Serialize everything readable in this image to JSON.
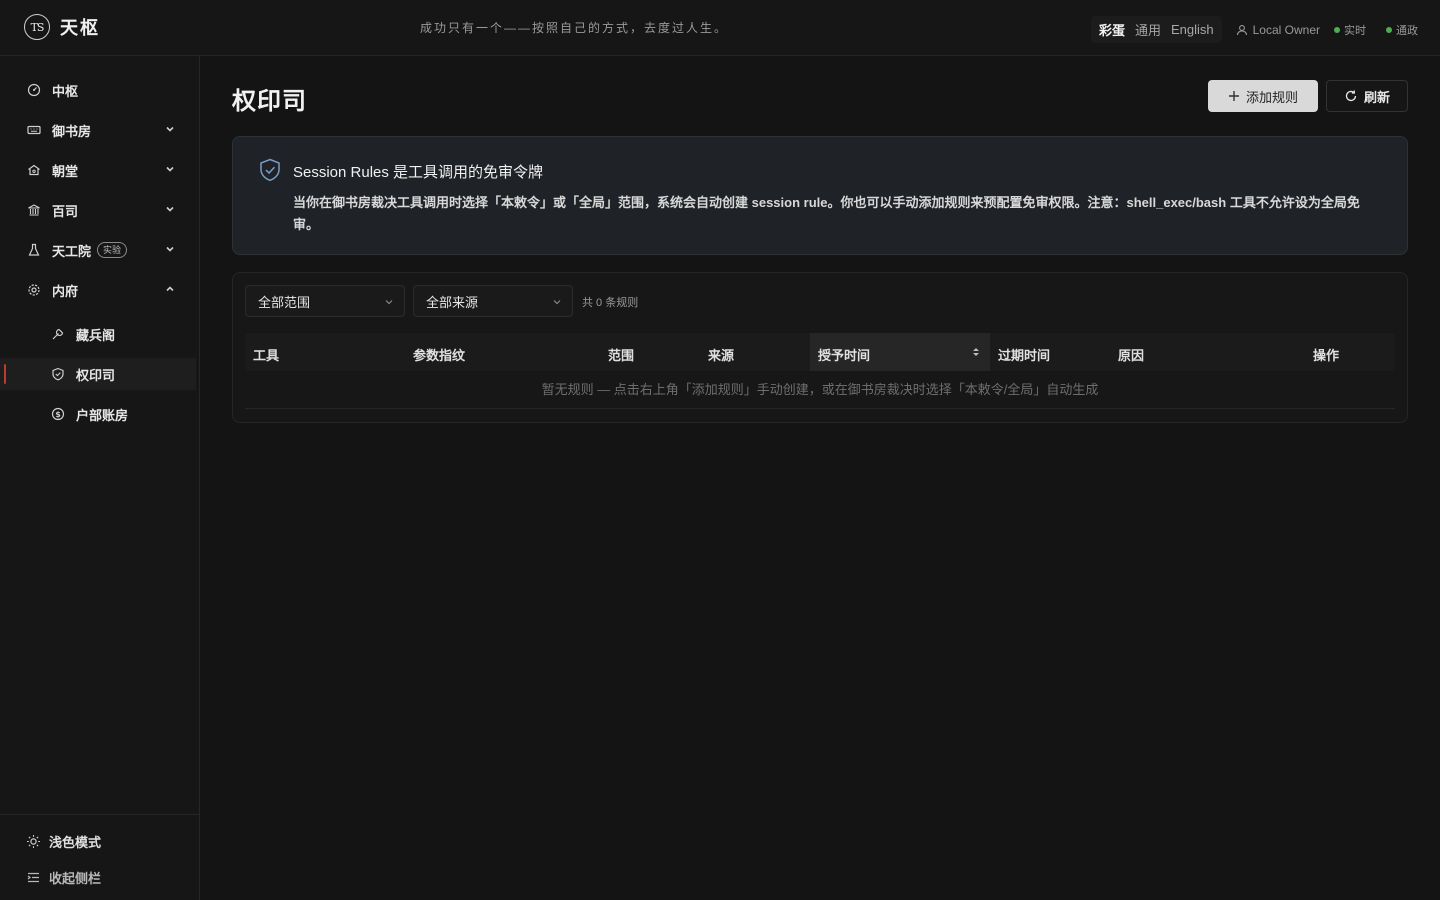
{
  "header": {
    "logo_text": "TS",
    "brand": "天枢",
    "motto": "成功只有一个——按照自己的方式，去度过人生。",
    "theme_options": [
      "彩蛋",
      "通用",
      "English"
    ],
    "active_theme": "彩蛋",
    "owner": "Local Owner",
    "status_realtime": "实时",
    "status_gov": "通政",
    "status_color": "#4caf50"
  },
  "sidebar": {
    "items": [
      {
        "label": "中枢",
        "icon": "dashboard-icon"
      },
      {
        "label": "御书房",
        "icon": "keyboard-icon",
        "expandable": true
      },
      {
        "label": "朝堂",
        "icon": "palace-icon",
        "expandable": true
      },
      {
        "label": "百司",
        "icon": "building-icon",
        "expandable": true
      },
      {
        "label": "天工院",
        "icon": "flask-icon",
        "expandable": true,
        "badge": "实验"
      },
      {
        "label": "内府",
        "icon": "gear-icon",
        "expandable": true,
        "expanded": true
      }
    ],
    "sub_items": [
      {
        "label": "藏兵阁",
        "icon": "wrench-icon"
      },
      {
        "label": "权印司",
        "icon": "shield-icon",
        "active": true
      },
      {
        "label": "户部账房",
        "icon": "coin-icon"
      }
    ],
    "footer": {
      "light_mode": "浅色模式",
      "collapse": "收起侧栏"
    },
    "active_color": "#c0392b"
  },
  "main": {
    "title": "权印司",
    "add_button": "添加规则",
    "refresh_button": "刷新",
    "info": {
      "title": "Session Rules 是工具调用的免审令牌",
      "text": "当你在御书房裁决工具调用时选择「本敕令」或「全局」范围，系统会自动创建 session rule。你也可以手动添加规则来预配置免审权限。注意：shell_exec/bash 工具不允许设为全局免审。"
    },
    "filters": {
      "scope": "全部范围",
      "source": "全部来源",
      "count": "共 0 条规则"
    },
    "table": {
      "columns": [
        "工具",
        "参数指纹",
        "范围",
        "来源",
        "授予时间",
        "过期时间",
        "原因",
        "操作"
      ],
      "sorted_column": "授予时间",
      "rows": [],
      "empty_text": "暂无规则 — 点击右上角「添加规则」手动创建，或在御书房裁决时选择「本敕令/全局」自动生成"
    }
  }
}
